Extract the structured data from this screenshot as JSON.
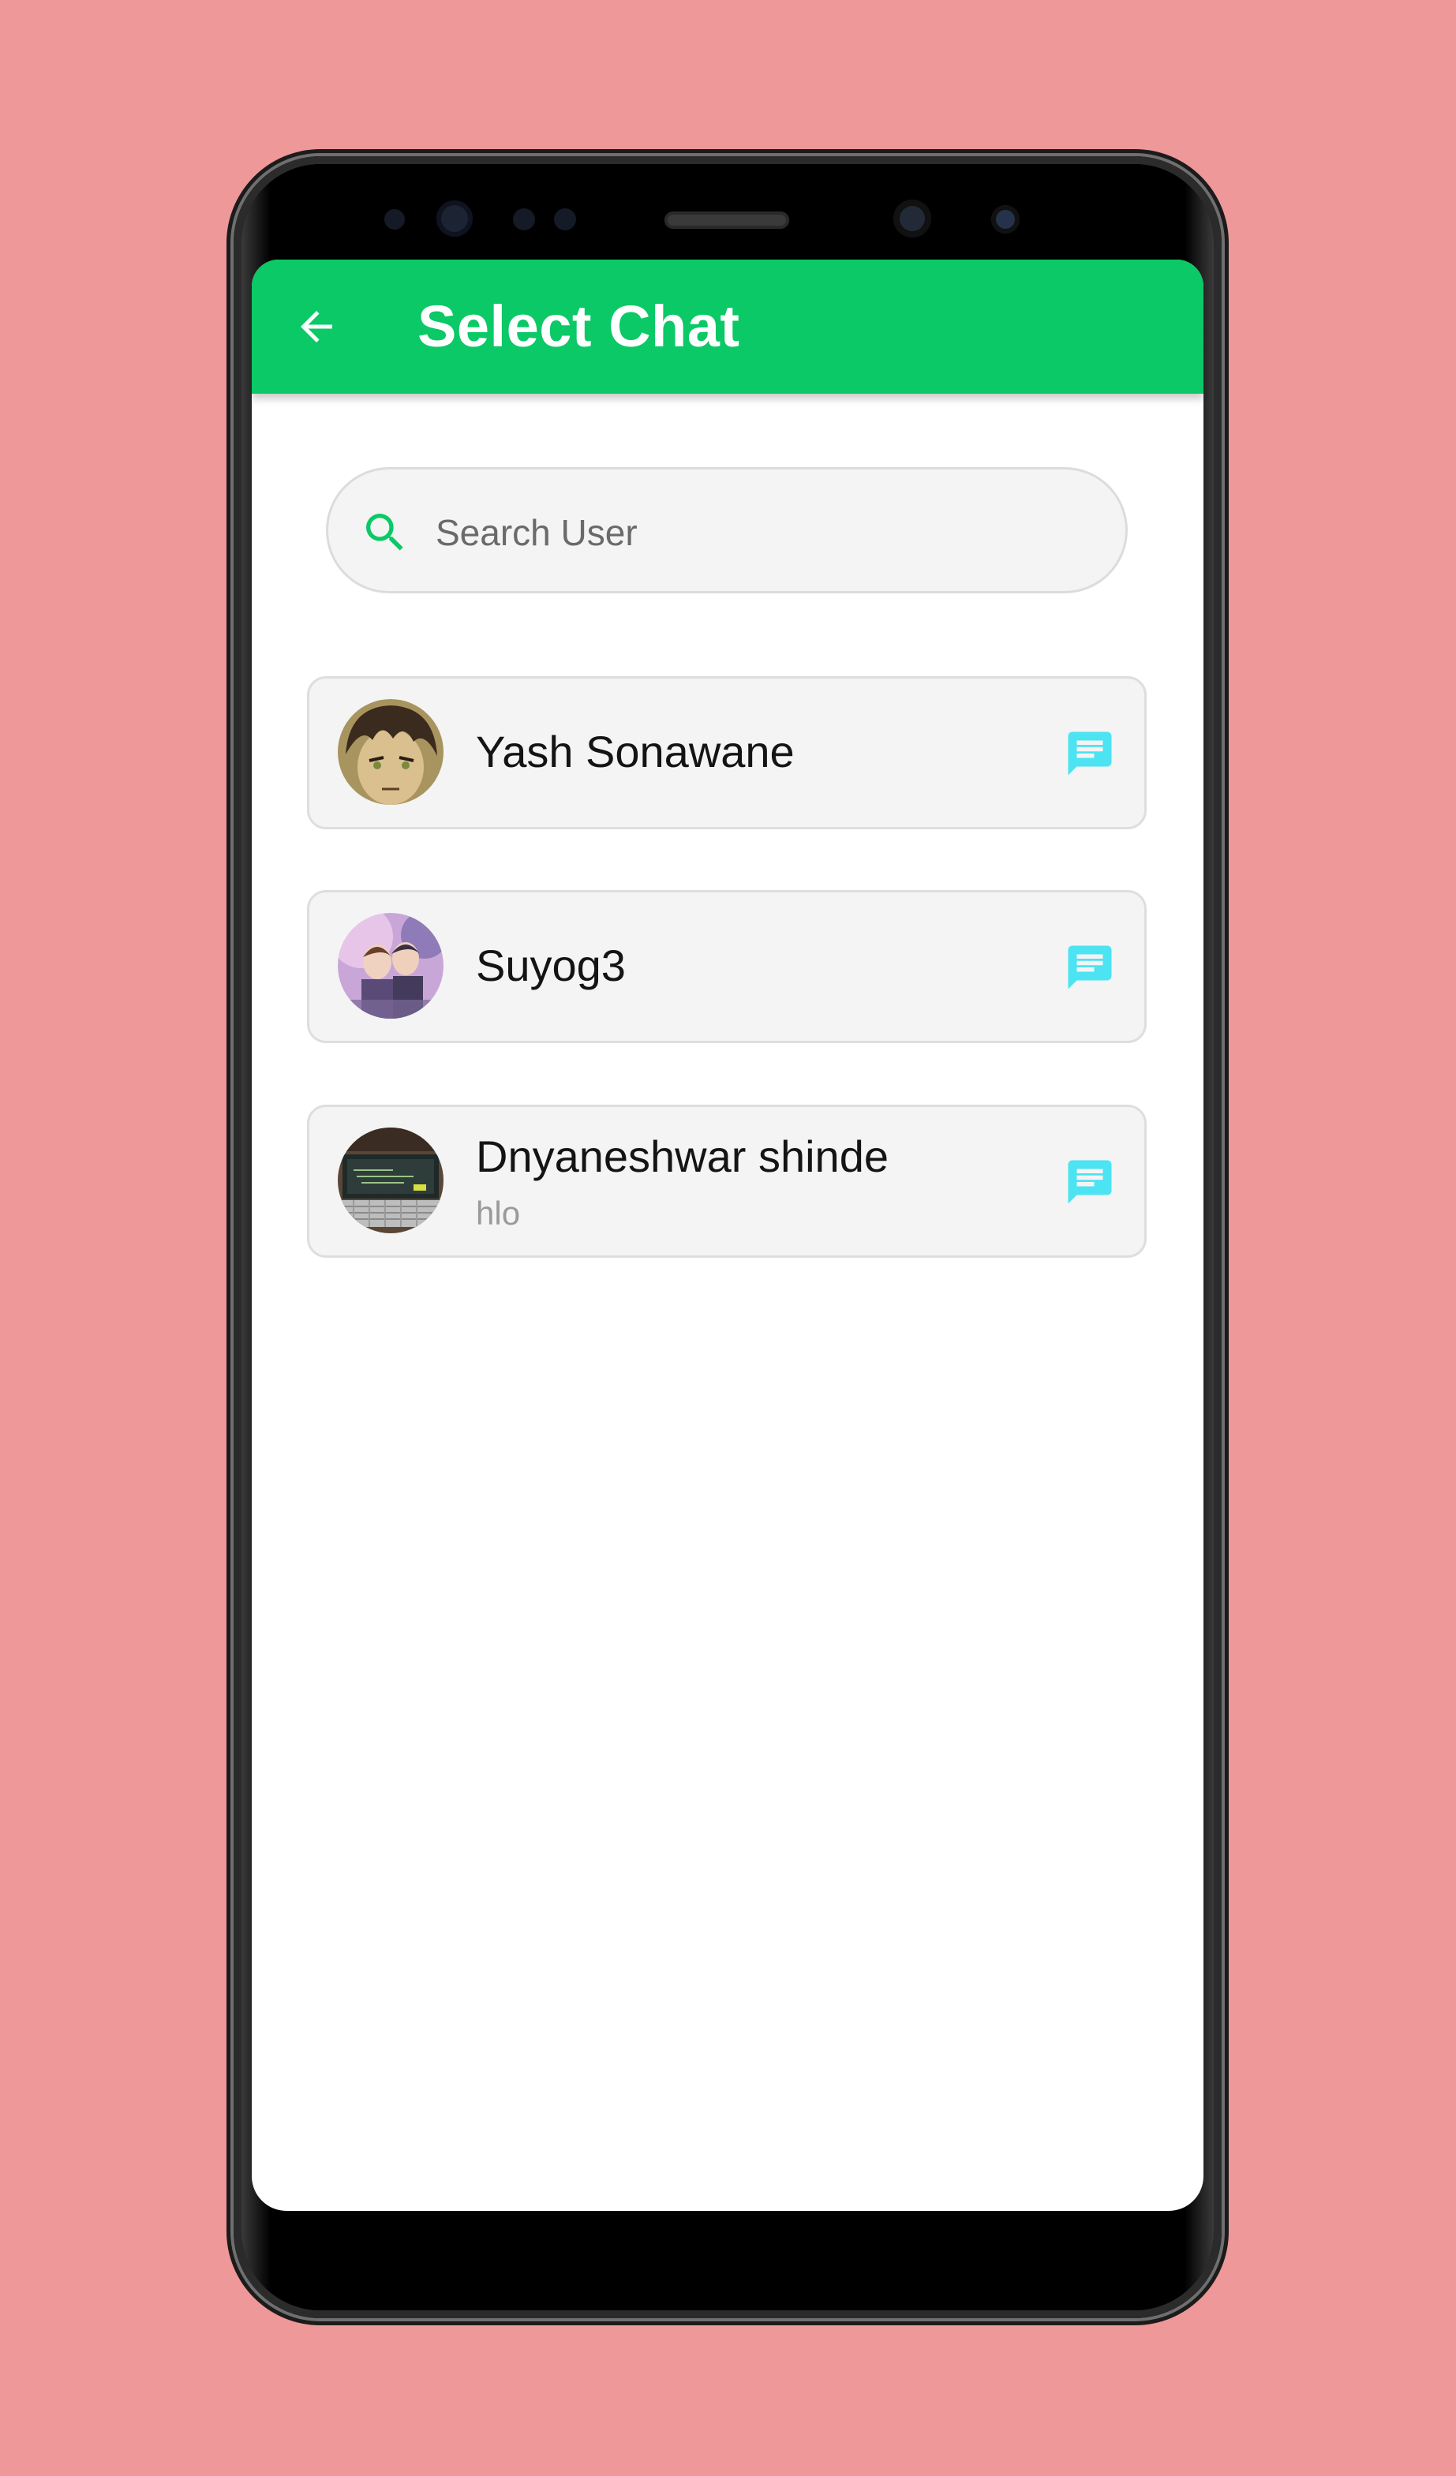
{
  "app": {
    "title": "Select Chat",
    "accent_color": "#0AC966",
    "message_icon_color": "#4CE3F2",
    "background_color": "#EE9899"
  },
  "toolbar": {
    "back_icon": "arrow-left-icon"
  },
  "search": {
    "placeholder": "Search User",
    "value": "",
    "icon": "search-icon"
  },
  "chats": [
    {
      "name": "Yash Sonawane",
      "last_message": "",
      "avatar": "anime-character-portrait",
      "action_icon": "chat-message-icon"
    },
    {
      "name": "Suyog3",
      "last_message": "",
      "avatar": "anime-group-artwork",
      "action_icon": "chat-message-icon"
    },
    {
      "name": "Dnyaneshwar shinde",
      "last_message": "hlo",
      "avatar": "laptop-photo",
      "action_icon": "chat-message-icon"
    }
  ]
}
